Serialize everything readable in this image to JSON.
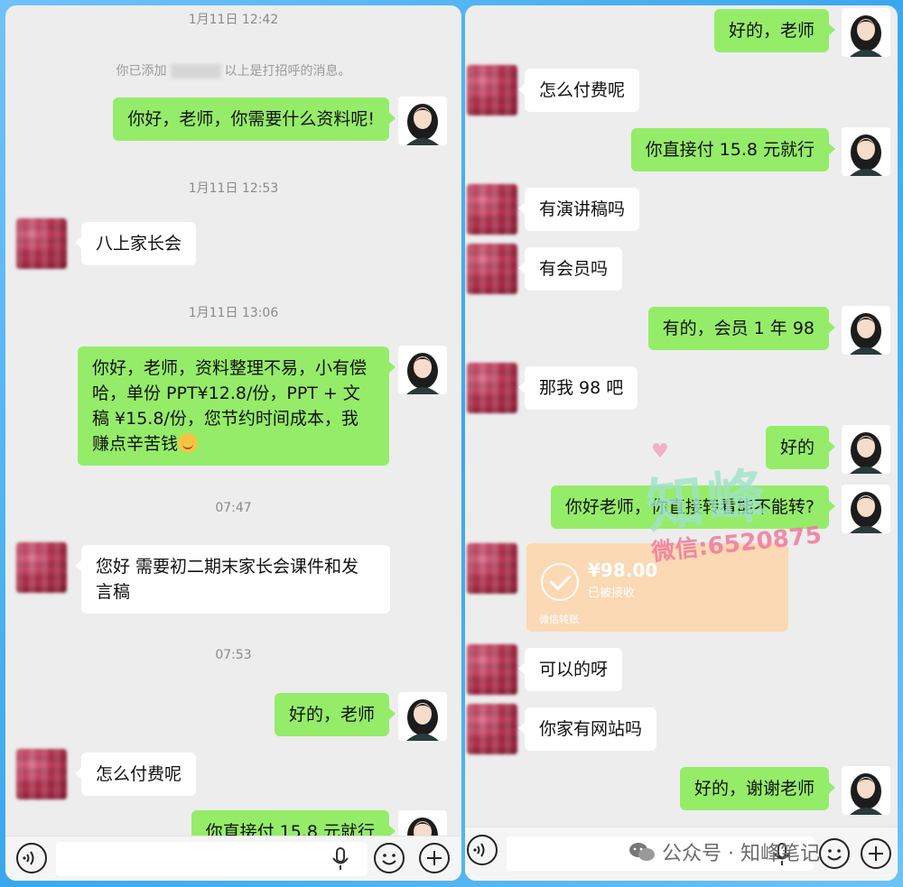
{
  "left": {
    "timestamps": [
      "1月11日 12:42",
      "1月11日 12:53",
      "1月11日 13:06",
      "07:47",
      "07:53"
    ],
    "system_prefix": "你已添加",
    "system_suffix": "以上是打招呼的消息。",
    "messages": [
      "你好，老师，你需要什么资料呢!",
      "八上家长会",
      "你好，老师，资料整理不易，小有偿哈，单份 PPT¥12.8/份，PPT + 文稿 ¥15.8/份，您节约时间成本，我赚点辛苦钱",
      "您好  需要初二期末家长会课件和发言稿",
      "好的，老师",
      "怎么付费呢",
      "你直接付 15.8 元就行"
    ]
  },
  "right": {
    "messages": [
      "好的，老师",
      "怎么付费呢",
      "你直接付 15.8 元就行",
      "有演讲稿吗",
      "有会员吗",
      "有的，会员 1 年 98",
      "那我 98 吧",
      "好的",
      "你好老师，你直接转看能不能转?",
      "可以的呀",
      "你家有网站吗",
      "好的，谢谢老师"
    ],
    "payment": {
      "amount": "¥98.00",
      "status": "已被接收",
      "footer": "微信转账"
    }
  },
  "watermark": {
    "main": "知峰",
    "wechat": "微信:6520875",
    "footer_text": "公众号 · 知峰笔记"
  },
  "icons": [
    "voice-icon",
    "microphone-icon",
    "emoji-icon",
    "plus-icon",
    "check-icon",
    "wechat-icon"
  ],
  "colors": {
    "self_bubble": "#95ec69",
    "other_bubble": "#ffffff",
    "chat_bg": "#ededed",
    "frame_bg": "#3aa8ee"
  }
}
